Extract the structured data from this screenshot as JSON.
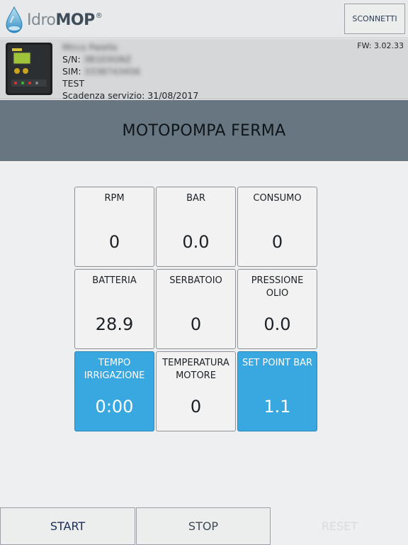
{
  "header": {
    "brand": {
      "part1": "Idro",
      "part2": "MOP",
      "registered": "®"
    },
    "connect_label": "SCONNETTI"
  },
  "device": {
    "name_redacted": "Mirco Paiello",
    "serial_label": "S/N:",
    "serial_redacted": "3B1E0GNZ",
    "sim_label": "SIM:",
    "sim_redacted": "3338743456",
    "name": "TEST",
    "service_expiry": "Scadenza servizio: 31/08/2017",
    "firmware": "FW: 3.02.33"
  },
  "status_text": "MOTOPOMPA FERMA",
  "tiles": [
    {
      "label": "RPM",
      "value": "0",
      "highlight": false
    },
    {
      "label": "BAR",
      "value": "0.0",
      "highlight": false
    },
    {
      "label": "CONSUMO",
      "value": "0",
      "highlight": false
    },
    {
      "label": "BATTERIA",
      "value": "28.9",
      "highlight": false
    },
    {
      "label": "SERBATOIO",
      "value": "0",
      "highlight": false
    },
    {
      "label": "PRESSIONE OLIO",
      "value": "0.0",
      "highlight": false
    },
    {
      "label": "TEMPO IRRIGAZIONE",
      "value": "0:00",
      "highlight": true
    },
    {
      "label": "TEMPERATURA MOTORE",
      "value": "0",
      "highlight": false
    },
    {
      "label": "SET POINT BAR",
      "value": "1.1",
      "highlight": true
    }
  ],
  "buttons": {
    "start": "START",
    "stop": "STOP",
    "reset": "RESET"
  },
  "colors": {
    "status_bg": "#677680",
    "tile_highlight": "#39a7e0",
    "header_bg": "#e8e9ea",
    "device_bg": "#d5d7d9"
  }
}
